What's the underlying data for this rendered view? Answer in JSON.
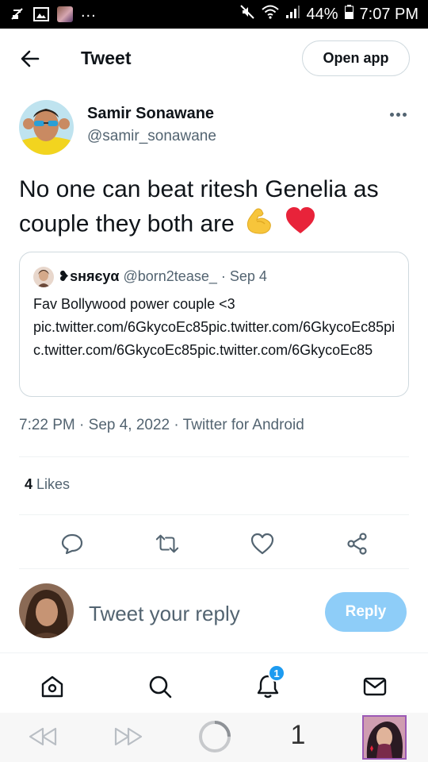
{
  "status_bar": {
    "battery": "44%",
    "time": "7:07 PM",
    "dots": "...",
    "icons": [
      "phonelink-off-icon",
      "image-icon",
      "thumbnail-icon",
      "mute-icon",
      "wifi-icon",
      "signal-icon",
      "battery-icon"
    ]
  },
  "header": {
    "title": "Tweet",
    "open_app": "Open app"
  },
  "tweet": {
    "author_name": "Samir Sonawane",
    "author_handle": "@samir_sonawane",
    "text": "No one can beat ritesh Genelia as couple they both are",
    "emojis": [
      "flexed-biceps-icon",
      "red-heart-icon"
    ],
    "quoted": {
      "name": "❥ѕняєуα",
      "handle": "@born2tease_",
      "dot": "·",
      "date": "Sep 4",
      "text_line1": "Fav Bollywood power couple <3",
      "text_rest": "pic.twitter.com/6GkycoEc85pic.twitter.com/6GkycoEc85pic.twitter.com/6GkycoEc85pic.twitter.com/6GkycoEc85"
    },
    "meta": "7:22 PM · Sep 4, 2022 · Twitter for Android",
    "likes_count": "4",
    "likes_label": "Likes"
  },
  "reply": {
    "placeholder": "Tweet your reply",
    "button": "Reply"
  },
  "bottom_nav": {
    "items": [
      "home-icon",
      "search-icon",
      "notifications-icon",
      "messages-icon"
    ],
    "notification_badge": "1"
  },
  "browser_bar": {
    "tab_count": "1"
  },
  "colors": {
    "accent": "#1d9bf0",
    "reply_button": "#8ecdf8",
    "secondary_text": "#536471",
    "border": "#cfd9de"
  }
}
